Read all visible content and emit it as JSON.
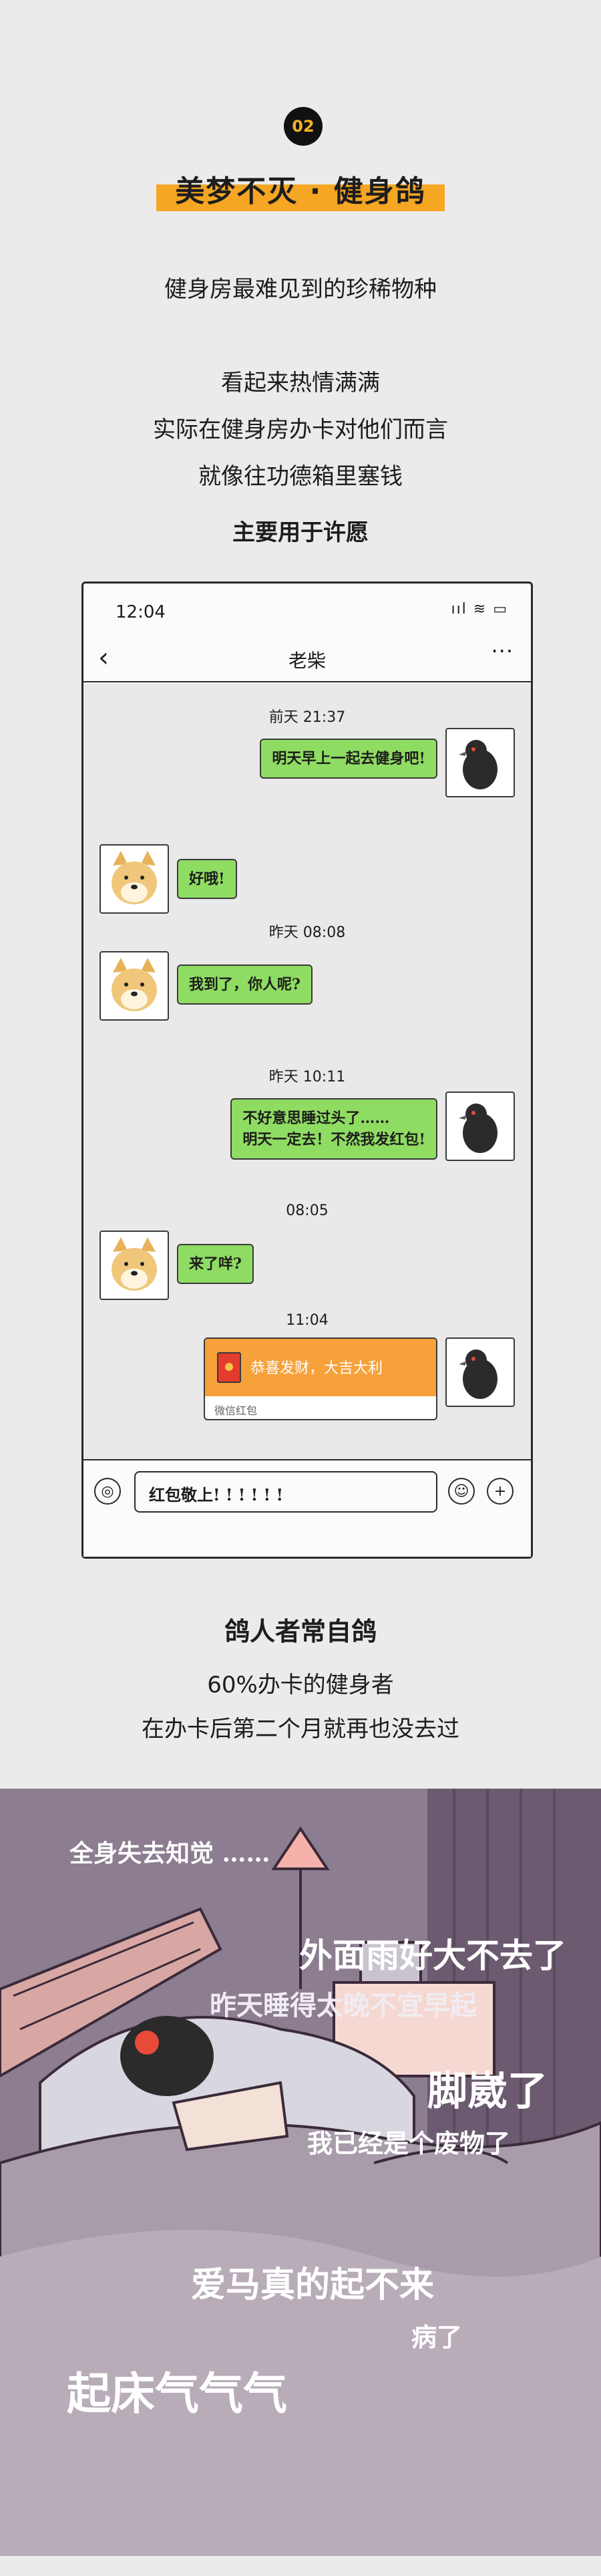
{
  "header": {
    "badge": "02",
    "title": "美梦不灭 · 健身鸽",
    "subtitle": "健身房最难见到的珍稀物种"
  },
  "intro": {
    "lines": [
      "看起来热情满满",
      "实际在健身房办卡对他们而言",
      "就像往功德箱里塞钱"
    ],
    "emphasis": "主要用于许愿"
  },
  "phone": {
    "time": "12:04",
    "status_icons": "ııl  ≋  ▭",
    "back_icon": "chevron-left-icon",
    "contact": "老柴",
    "more": "···",
    "messages": [
      {
        "stamp": "前天 21:37",
        "from": "pigeon",
        "text": "明天早上一起去健身吧!"
      },
      {
        "from": "doge",
        "text": "好哦!"
      },
      {
        "stamp": "昨天 08:08",
        "from": "doge",
        "text": "我到了，你人呢?"
      },
      {
        "stamp": "昨天 10:11",
        "from": "pigeon",
        "text": "不好意思睡过头了……\n明天一定去！不然我发红包!"
      },
      {
        "stamp": "08:05",
        "from": "doge",
        "text": "来了咩?"
      },
      {
        "stamp": "11:04",
        "from": "pigeon",
        "type": "red-packet",
        "text": "恭喜发财，大吉大利",
        "label": "微信红包"
      }
    ],
    "input_value": "红包敬上! ! ! ! ! !",
    "voice_icon": "voice-icon",
    "emoji_icon": "emoji-icon",
    "plus_icon": "plus-icon"
  },
  "section2": {
    "heading": "鸽人者常自鸽",
    "lines": [
      "60%办卡的健身者",
      "在办卡后第二个月就再也没去过"
    ]
  },
  "scene": {
    "texts": [
      "全身失去知觉 ……",
      "外面雨好大不去了",
      "昨天睡得太晚不宜早起",
      "脚崴了",
      "我已经是个废物了",
      "爱马真的起不来",
      "病了",
      "起床气气气"
    ]
  },
  "colors": {
    "accent": "#f5a623",
    "bubble_green": "#8fdc62",
    "red_packet": "#f7a13b"
  }
}
